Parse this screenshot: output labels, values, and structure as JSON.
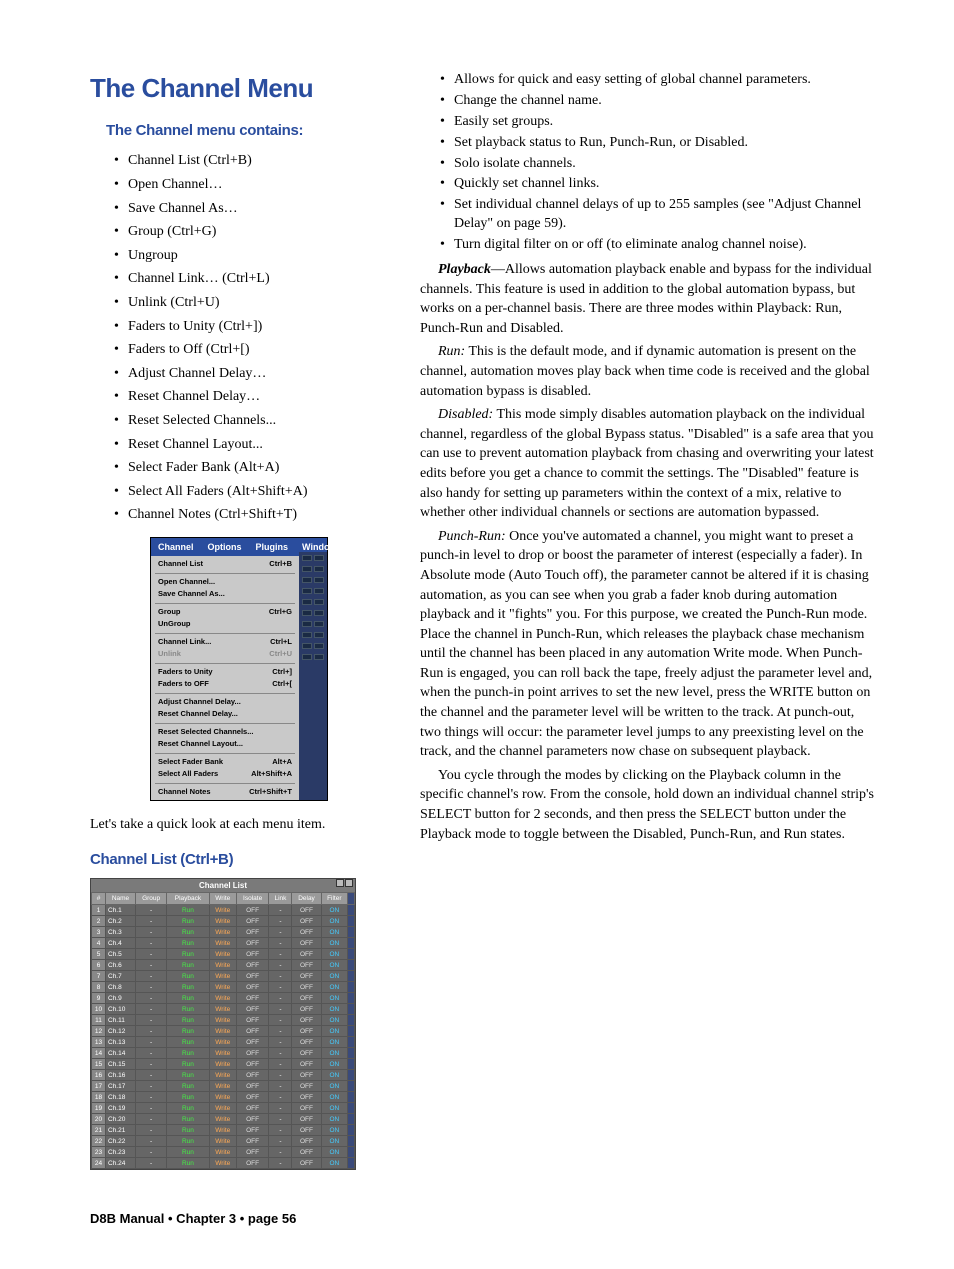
{
  "title": "The Channel Menu",
  "subtitle": "The Channel menu contains:",
  "menu_items": [
    "Channel List (Ctrl+B)",
    "Open Channel…",
    "Save Channel As…",
    "Group (Ctrl+G)",
    "Ungroup",
    "Channel Link… (Ctrl+L)",
    "Unlink (Ctrl+U)",
    "Faders to Unity (Ctrl+])",
    "Faders to Off (Ctrl+[)",
    "Adjust Channel Delay…",
    "Reset Channel Delay…",
    "Reset Selected Channels...",
    "Reset Channel Layout...",
    "Select Fader Bank (Alt+A)",
    "Select All Faders (Alt+Shift+A)",
    "Channel Notes (Ctrl+Shift+T)"
  ],
  "menushot": {
    "bar": [
      "Channel",
      "Options",
      "Plugins",
      "Windows"
    ],
    "rows": [
      {
        "label": "Channel List",
        "sc": "Ctrl+B"
      },
      {
        "div": true
      },
      {
        "label": "Open Channel...",
        "sc": ""
      },
      {
        "label": "Save Channel As...",
        "sc": ""
      },
      {
        "div": true
      },
      {
        "label": "Group",
        "sc": "Ctrl+G"
      },
      {
        "label": "UnGroup",
        "sc": ""
      },
      {
        "div": true
      },
      {
        "label": "Channel Link...",
        "sc": "Ctrl+L"
      },
      {
        "label": "Unlink",
        "sc": "Ctrl+U",
        "dim": true
      },
      {
        "div": true
      },
      {
        "label": "Faders to Unity",
        "sc": "Ctrl+]"
      },
      {
        "label": "Faders to OFF",
        "sc": "Ctrl+["
      },
      {
        "div": true
      },
      {
        "label": "Adjust Channel Delay...",
        "sc": ""
      },
      {
        "label": "Reset Channel Delay...",
        "sc": ""
      },
      {
        "div": true
      },
      {
        "label": "Reset Selected Channels...",
        "sc": ""
      },
      {
        "label": "Reset Channel Layout...",
        "sc": ""
      },
      {
        "div": true
      },
      {
        "label": "Select Fader Bank",
        "sc": "Alt+A"
      },
      {
        "label": "Select All Faders",
        "sc": "Alt+Shift+A"
      },
      {
        "div": true
      },
      {
        "label": "Channel Notes",
        "sc": "Ctrl+Shift+T"
      }
    ]
  },
  "intro_p": "Let's take a quick look at each menu item.",
  "section2": "Channel List (Ctrl+B)",
  "channel_list": {
    "title": "Channel List",
    "headers": [
      "#",
      "Name",
      "Group",
      "Playback",
      "Write",
      "Isolate",
      "Link",
      "Delay",
      "Filter"
    ],
    "rows": [
      {
        "n": 1,
        "name": "Ch.1",
        "g": "-",
        "pb": "Run",
        "w": "Write",
        "iso": "OFF",
        "lk": "-",
        "d": "OFF",
        "f": "ON"
      },
      {
        "n": 2,
        "name": "Ch.2",
        "g": "-",
        "pb": "Run",
        "w": "Write",
        "iso": "OFF",
        "lk": "-",
        "d": "OFF",
        "f": "ON"
      },
      {
        "n": 3,
        "name": "Ch.3",
        "g": "-",
        "pb": "Run",
        "w": "Write",
        "iso": "OFF",
        "lk": "-",
        "d": "OFF",
        "f": "ON"
      },
      {
        "n": 4,
        "name": "Ch.4",
        "g": "-",
        "pb": "Run",
        "w": "Write",
        "iso": "OFF",
        "lk": "-",
        "d": "OFF",
        "f": "ON"
      },
      {
        "n": 5,
        "name": "Ch.5",
        "g": "-",
        "pb": "Run",
        "w": "Write",
        "iso": "OFF",
        "lk": "-",
        "d": "OFF",
        "f": "ON"
      },
      {
        "n": 6,
        "name": "Ch.6",
        "g": "-",
        "pb": "Run",
        "w": "Write",
        "iso": "OFF",
        "lk": "-",
        "d": "OFF",
        "f": "ON"
      },
      {
        "n": 7,
        "name": "Ch.7",
        "g": "-",
        "pb": "Run",
        "w": "Write",
        "iso": "OFF",
        "lk": "-",
        "d": "OFF",
        "f": "ON"
      },
      {
        "n": 8,
        "name": "Ch.8",
        "g": "-",
        "pb": "Run",
        "w": "Write",
        "iso": "OFF",
        "lk": "-",
        "d": "OFF",
        "f": "ON"
      },
      {
        "n": 9,
        "name": "Ch.9",
        "g": "-",
        "pb": "Run",
        "w": "Write",
        "iso": "OFF",
        "lk": "-",
        "d": "OFF",
        "f": "ON"
      },
      {
        "n": 10,
        "name": "Ch.10",
        "g": "-",
        "pb": "Run",
        "w": "Write",
        "iso": "OFF",
        "lk": "-",
        "d": "OFF",
        "f": "ON"
      },
      {
        "n": 11,
        "name": "Ch.11",
        "g": "-",
        "pb": "Run",
        "w": "Write",
        "iso": "OFF",
        "lk": "-",
        "d": "OFF",
        "f": "ON"
      },
      {
        "n": 12,
        "name": "Ch.12",
        "g": "-",
        "pb": "Run",
        "w": "Write",
        "iso": "OFF",
        "lk": "-",
        "d": "OFF",
        "f": "ON"
      },
      {
        "n": 13,
        "name": "Ch.13",
        "g": "-",
        "pb": "Run",
        "w": "Write",
        "iso": "OFF",
        "lk": "-",
        "d": "OFF",
        "f": "ON"
      },
      {
        "n": 14,
        "name": "Ch.14",
        "g": "-",
        "pb": "Run",
        "w": "Write",
        "iso": "OFF",
        "lk": "-",
        "d": "OFF",
        "f": "ON"
      },
      {
        "n": 15,
        "name": "Ch.15",
        "g": "-",
        "pb": "Run",
        "w": "Write",
        "iso": "OFF",
        "lk": "-",
        "d": "OFF",
        "f": "ON"
      },
      {
        "n": 16,
        "name": "Ch.16",
        "g": "-",
        "pb": "Run",
        "w": "Write",
        "iso": "OFF",
        "lk": "-",
        "d": "OFF",
        "f": "ON"
      },
      {
        "n": 17,
        "name": "Ch.17",
        "g": "-",
        "pb": "Run",
        "w": "Write",
        "iso": "OFF",
        "lk": "-",
        "d": "OFF",
        "f": "ON"
      },
      {
        "n": 18,
        "name": "Ch.18",
        "g": "-",
        "pb": "Run",
        "w": "Write",
        "iso": "OFF",
        "lk": "-",
        "d": "OFF",
        "f": "ON"
      },
      {
        "n": 19,
        "name": "Ch.19",
        "g": "-",
        "pb": "Run",
        "w": "Write",
        "iso": "OFF",
        "lk": "-",
        "d": "OFF",
        "f": "ON"
      },
      {
        "n": 20,
        "name": "Ch.20",
        "g": "-",
        "pb": "Run",
        "w": "Write",
        "iso": "OFF",
        "lk": "-",
        "d": "OFF",
        "f": "ON"
      },
      {
        "n": 21,
        "name": "Ch.21",
        "g": "-",
        "pb": "Run",
        "w": "Write",
        "iso": "OFF",
        "lk": "-",
        "d": "OFF",
        "f": "ON"
      },
      {
        "n": 22,
        "name": "Ch.22",
        "g": "-",
        "pb": "Run",
        "w": "Write",
        "iso": "OFF",
        "lk": "-",
        "d": "OFF",
        "f": "ON"
      },
      {
        "n": 23,
        "name": "Ch.23",
        "g": "-",
        "pb": "Run",
        "w": "Write",
        "iso": "OFF",
        "lk": "-",
        "d": "OFF",
        "f": "ON"
      },
      {
        "n": 24,
        "name": "Ch.24",
        "g": "-",
        "pb": "Run",
        "w": "Write",
        "iso": "OFF",
        "lk": "-",
        "d": "OFF",
        "f": "ON"
      }
    ]
  },
  "right_bullets": [
    "Allows for quick and easy setting of global channel parameters.",
    "Change the channel name.",
    "Easily set groups.",
    "Set playback status to Run, Punch-Run, or Disabled.",
    "Solo isolate channels.",
    "Quickly set channel links.",
    "Set individual channel delays of up to 255 samples (see \"Adjust Channel Delay\" on page 59).",
    "Turn digital filter on or off (to eliminate analog channel noise)."
  ],
  "p_playback_lead": "Playback",
  "p_playback": "—Allows automation playback enable and bypass for the individual channels. This feature is used in addition to the global automation bypass, but works on a per-channel basis. There are three modes within Playback: Run, Punch-Run and Disabled.",
  "p_run_lead": "Run:",
  "p_run": " This is the default mode, and if dynamic automation is present on the channel, automation moves play back when time code is received and the global automation bypass is disabled.",
  "p_disabled_lead": "Disabled:",
  "p_disabled": " This mode simply disables automation playback on the individual channel, regardless of the global Bypass status. \"Disabled\" is a safe area that you can use to prevent automation playback from chasing and overwriting your latest edits before you get a chance to commit the settings. The \"Disabled\" feature is also handy for setting up parameters within the context of a mix, relative to whether other individual channels or sections are automation bypassed.",
  "p_punchrun_lead": "Punch-Run:",
  "p_punchrun": " Once you've automated a channel, you might want to preset a punch-in level to drop or boost the parameter of interest (especially a fader). In Absolute mode (Auto Touch off), the parameter cannot be altered if it is chasing automation, as you can see when you grab a fader knob during automation playback and it \"fights\" you. For this purpose, we created the Punch-Run mode. Place the channel in Punch-Run, which releases the playback chase mechanism until the channel has been placed in any automation Write mode. When Punch-Run is engaged, you can roll back the tape, freely adjust the parameter level and, when the punch-in point arrives to set the new level, press the WRITE button on the channel and the parameter level will be written to the track. At punch-out, two things will occur: the parameter level jumps to any preexisting level on the track, and the channel parameters now chase on subsequent playback.",
  "p_cycle": "You cycle through the modes by clicking on the Playback column in the specific channel's row. From the console, hold down an individual channel strip's SELECT button for 2 seconds, and then press the SELECT button under the Playback mode to toggle between the Disabled, Punch-Run, and Run states.",
  "footer": "D8B Manual • Chapter 3 • page  56"
}
